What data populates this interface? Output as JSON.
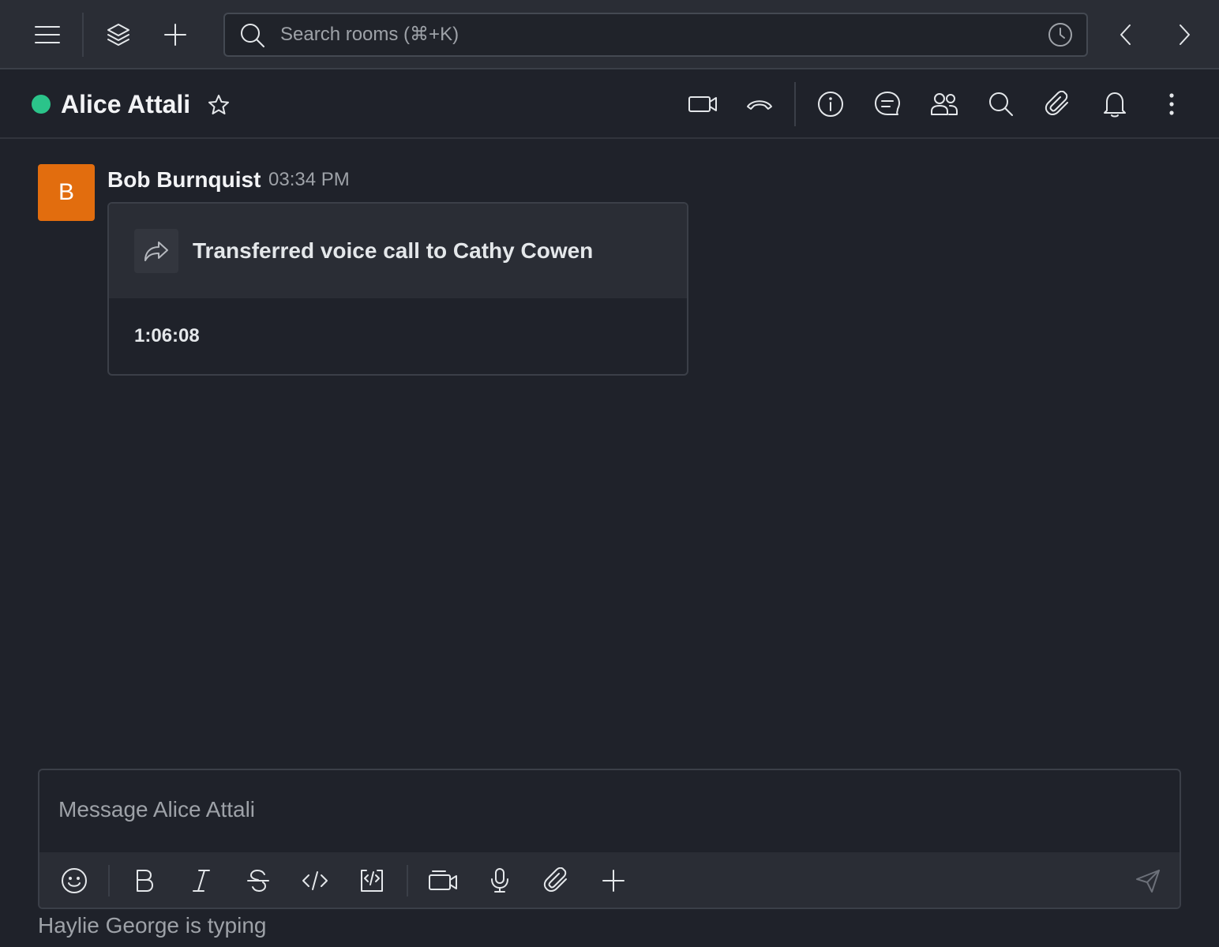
{
  "navbar": {
    "search_placeholder": "Search rooms (⌘+K)",
    "icons": [
      "menu-icon",
      "layers-icon",
      "plus-icon",
      "search-icon",
      "history-icon",
      "chevron-left-icon",
      "chevron-right-icon"
    ]
  },
  "room": {
    "name": "Alice Attali",
    "status_color": "#2bc48a",
    "header_icons": [
      "video-icon",
      "phone-hangup-icon",
      "info-icon",
      "discussion-icon",
      "members-icon",
      "search-icon",
      "attachment-icon",
      "bell-icon",
      "kebab-icon"
    ]
  },
  "messages": [
    {
      "avatar_letter": "B",
      "avatar_color": "#e26d0e",
      "author": "Bob Burnquist",
      "time": "03:34 PM",
      "call": {
        "title": "Transferred voice call to Cathy Cowen",
        "duration": "1:06:08",
        "icon": "forward-arrow-icon"
      }
    }
  ],
  "composer": {
    "placeholder": "Message Alice Attali",
    "tools": [
      "emoji-icon",
      "bold-icon",
      "italic-icon",
      "strike-icon",
      "code-icon",
      "code-block-icon",
      "video-message-icon",
      "microphone-icon",
      "attachment-icon",
      "plus-icon",
      "send-icon"
    ]
  },
  "typing_indicator": "Haylie George is typing"
}
